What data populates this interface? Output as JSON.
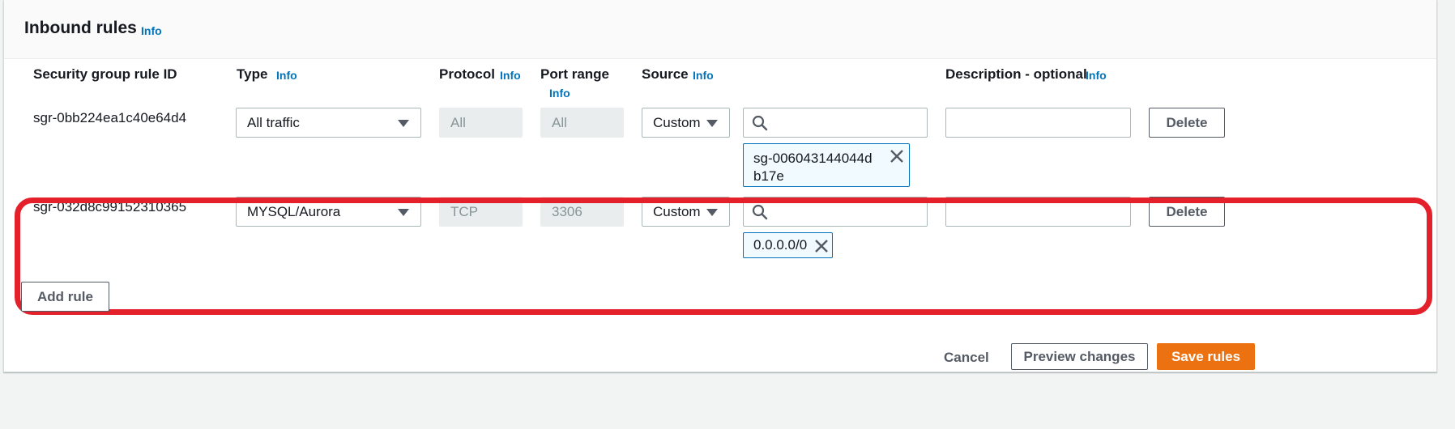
{
  "section": {
    "title": "Inbound rules",
    "info_label": "Info"
  },
  "columns": {
    "rule_id": "Security group rule ID",
    "type": "Type",
    "protocol": "Protocol",
    "port_range": "Port range",
    "source": "Source",
    "description": "Description - optional",
    "info_label": "Info"
  },
  "rules": [
    {
      "id": "sgr-0bb224ea1c40e64d4",
      "type": "All traffic",
      "protocol": "All",
      "port_range": "All",
      "source_type": "Custom",
      "source_search": "",
      "source_token": "sg-006043144044db17e",
      "description": "",
      "delete_label": "Delete"
    },
    {
      "id": "sgr-032d8c99152310365",
      "type": "MYSQL/Aurora",
      "protocol": "TCP",
      "port_range": "3306",
      "source_type": "Custom",
      "source_search": "",
      "source_token": "0.0.0.0/0",
      "description": "",
      "delete_label": "Delete"
    }
  ],
  "actions": {
    "add_rule": "Add rule",
    "cancel": "Cancel",
    "preview": "Preview changes",
    "save": "Save rules"
  },
  "icons": {
    "search": "search-icon",
    "caret": "caret-down-icon",
    "remove": "close-icon"
  },
  "colors": {
    "link": "#0073bb",
    "primary": "#ec7211",
    "highlight": "#e4212b",
    "token_bg": "#f1faff"
  }
}
